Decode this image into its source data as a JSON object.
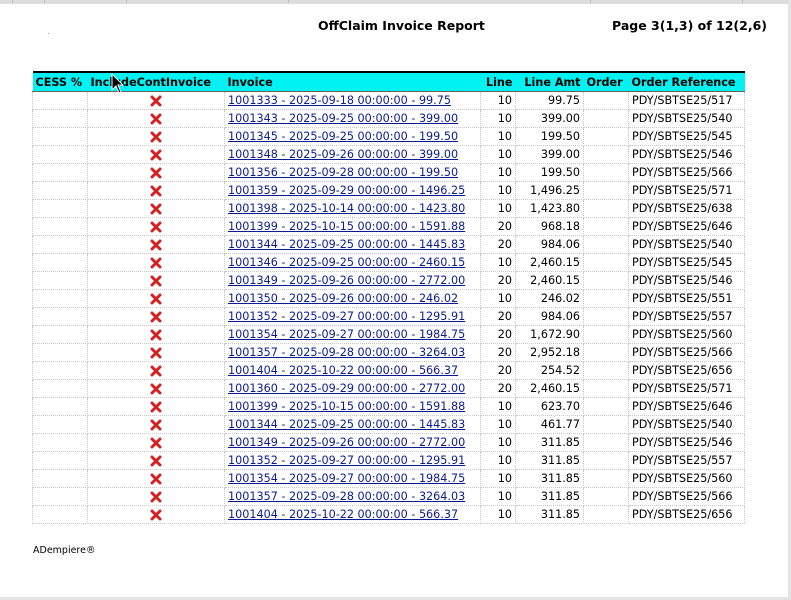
{
  "header": {
    "title": "OffClaim Invoice Report",
    "page_info": "Page 3(1,3) of 12(2,6)"
  },
  "columns": {
    "cess": "CESS %",
    "include": "IncludeContInvoice",
    "invoice": "Invoice",
    "line": "Line",
    "line_amt": "Line Amt",
    "order": "Order",
    "order_ref": "Order Reference"
  },
  "include_icon": "red-x-icon",
  "rows": [
    {
      "cess": "",
      "invoice": "1001333 - 2025-09-18 00:00:00 - 99.75",
      "line": "10",
      "amt": "99.75",
      "order": "",
      "ref": "PDY/SBTSE25/517"
    },
    {
      "cess": "",
      "invoice": "1001343 - 2025-09-25 00:00:00 - 399.00",
      "line": "10",
      "amt": "399.00",
      "order": "",
      "ref": "PDY/SBTSE25/540"
    },
    {
      "cess": "",
      "invoice": "1001345 - 2025-09-25 00:00:00 - 199.50",
      "line": "10",
      "amt": "199.50",
      "order": "",
      "ref": "PDY/SBTSE25/545"
    },
    {
      "cess": "",
      "invoice": "1001348 - 2025-09-26 00:00:00 - 399.00",
      "line": "10",
      "amt": "399.00",
      "order": "",
      "ref": "PDY/SBTSE25/546"
    },
    {
      "cess": "",
      "invoice": "1001356 - 2025-09-28 00:00:00 - 199.50",
      "line": "10",
      "amt": "199.50",
      "order": "",
      "ref": "PDY/SBTSE25/566"
    },
    {
      "cess": "",
      "invoice": "1001359 - 2025-09-29 00:00:00 - 1496.25",
      "line": "10",
      "amt": "1,496.25",
      "order": "",
      "ref": "PDY/SBTSE25/571"
    },
    {
      "cess": "",
      "invoice": "1001398 - 2025-10-14 00:00:00 - 1423.80",
      "line": "10",
      "amt": "1,423.80",
      "order": "",
      "ref": "PDY/SBTSE25/638"
    },
    {
      "cess": "",
      "invoice": "1001399 - 2025-10-15 00:00:00 - 1591.88",
      "line": "20",
      "amt": "968.18",
      "order": "",
      "ref": "PDY/SBTSE25/646"
    },
    {
      "cess": "",
      "invoice": "1001344 - 2025-09-25 00:00:00 - 1445.83",
      "line": "20",
      "amt": "984.06",
      "order": "",
      "ref": "PDY/SBTSE25/540"
    },
    {
      "cess": "",
      "invoice": "1001346 - 2025-09-25 00:00:00 - 2460.15",
      "line": "10",
      "amt": "2,460.15",
      "order": "",
      "ref": "PDY/SBTSE25/545"
    },
    {
      "cess": "",
      "invoice": "1001349 - 2025-09-26 00:00:00 - 2772.00",
      "line": "20",
      "amt": "2,460.15",
      "order": "",
      "ref": "PDY/SBTSE25/546"
    },
    {
      "cess": "",
      "invoice": "1001350 - 2025-09-26 00:00:00 - 246.02",
      "line": "10",
      "amt": "246.02",
      "order": "",
      "ref": "PDY/SBTSE25/551"
    },
    {
      "cess": "",
      "invoice": "1001352 - 2025-09-27 00:00:00 - 1295.91",
      "line": "20",
      "amt": "984.06",
      "order": "",
      "ref": "PDY/SBTSE25/557"
    },
    {
      "cess": "",
      "invoice": "1001354 - 2025-09-27 00:00:00 - 1984.75",
      "line": "20",
      "amt": "1,672.90",
      "order": "",
      "ref": "PDY/SBTSE25/560"
    },
    {
      "cess": "",
      "invoice": "1001357 - 2025-09-28 00:00:00 - 3264.03",
      "line": "20",
      "amt": "2,952.18",
      "order": "",
      "ref": "PDY/SBTSE25/566"
    },
    {
      "cess": "",
      "invoice": "1001404 - 2025-10-22 00:00:00 - 566.37",
      "line": "20",
      "amt": "254.52",
      "order": "",
      "ref": "PDY/SBTSE25/656"
    },
    {
      "cess": "",
      "invoice": "1001360 - 2025-09-29 00:00:00 - 2772.00",
      "line": "20",
      "amt": "2,460.15",
      "order": "",
      "ref": "PDY/SBTSE25/571"
    },
    {
      "cess": "",
      "invoice": "1001399 - 2025-10-15 00:00:00 - 1591.88",
      "line": "10",
      "amt": "623.70",
      "order": "",
      "ref": "PDY/SBTSE25/646"
    },
    {
      "cess": "",
      "invoice": "1001344 - 2025-09-25 00:00:00 - 1445.83",
      "line": "10",
      "amt": "461.77",
      "order": "",
      "ref": "PDY/SBTSE25/540"
    },
    {
      "cess": "",
      "invoice": "1001349 - 2025-09-26 00:00:00 - 2772.00",
      "line": "10",
      "amt": "311.85",
      "order": "",
      "ref": "PDY/SBTSE25/546"
    },
    {
      "cess": "",
      "invoice": "1001352 - 2025-09-27 00:00:00 - 1295.91",
      "line": "10",
      "amt": "311.85",
      "order": "",
      "ref": "PDY/SBTSE25/557"
    },
    {
      "cess": "",
      "invoice": "1001354 - 2025-09-27 00:00:00 - 1984.75",
      "line": "10",
      "amt": "311.85",
      "order": "",
      "ref": "PDY/SBTSE25/560"
    },
    {
      "cess": "",
      "invoice": "1001357 - 2025-09-28 00:00:00 - 3264.03",
      "line": "10",
      "amt": "311.85",
      "order": "",
      "ref": "PDY/SBTSE25/566"
    },
    {
      "cess": "",
      "invoice": "1001404 - 2025-10-22 00:00:00 - 566.37",
      "line": "10",
      "amt": "311.85",
      "order": "",
      "ref": "PDY/SBTSE25/656"
    }
  ],
  "footer": {
    "brand": "ADempiere®"
  },
  "colors": {
    "header_bg": "#00f2f2",
    "link": "#0b1c8f",
    "x_icon": "#d42020"
  }
}
